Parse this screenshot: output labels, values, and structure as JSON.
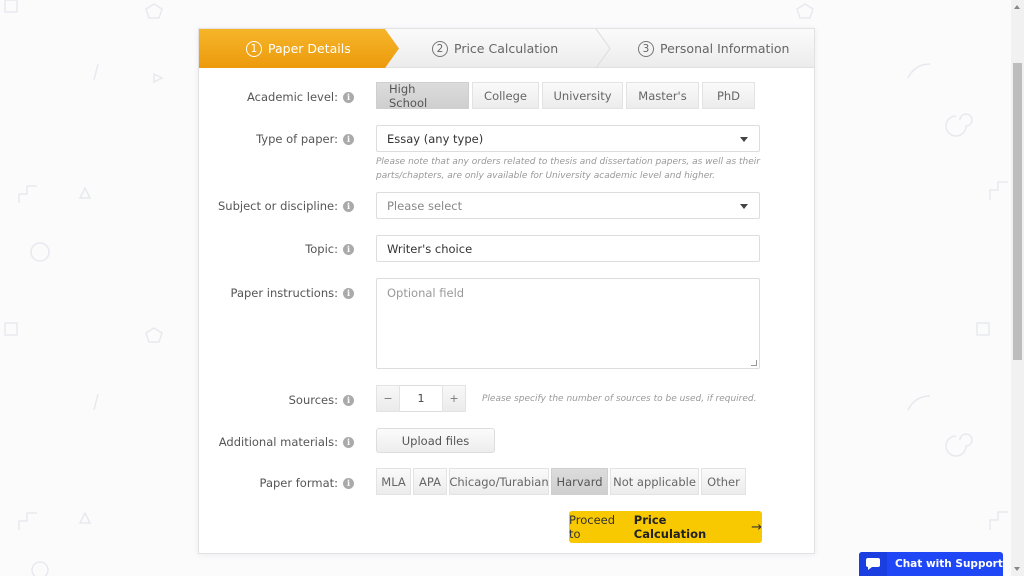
{
  "steps": [
    {
      "num": "1",
      "label": "Paper Details",
      "active": true
    },
    {
      "num": "2",
      "label": "Price Calculation",
      "active": false
    },
    {
      "num": "3",
      "label": "Personal Information",
      "active": false
    }
  ],
  "form": {
    "academic_level": {
      "label": "Academic level:",
      "options": [
        "High School",
        "College",
        "University",
        "Master's",
        "PhD"
      ],
      "selected": "High School"
    },
    "type_of_paper": {
      "label": "Type of paper:",
      "value": "Essay (any type)",
      "note": "Please note that any orders related to thesis and dissertation papers, as well as their parts/chapters, are only available for University academic level and higher."
    },
    "subject": {
      "label": "Subject or discipline:",
      "placeholder": "Please select"
    },
    "topic": {
      "label": "Topic:",
      "value": "Writer's choice"
    },
    "instructions": {
      "label": "Paper instructions:",
      "placeholder": "Optional field"
    },
    "sources": {
      "label": "Sources:",
      "minus": "−",
      "value": "1",
      "plus": "+",
      "hint": "Please specify the number of sources to be used, if required."
    },
    "additional_materials": {
      "label": "Additional materials:",
      "button": "Upload files"
    },
    "paper_format": {
      "label": "Paper format:",
      "options": [
        "MLA",
        "APA",
        "Chicago/Turabian",
        "Harvard",
        "Not applicable",
        "Other"
      ],
      "selected": "Harvard"
    },
    "info_icon": "i"
  },
  "proceed": {
    "prefix": "Proceed to",
    "bold": "Price Calculation",
    "arrow": "→"
  },
  "chat": {
    "label": "Chat with Support"
  },
  "colors": {
    "accent_orange": "#f0a21a",
    "proceed_yellow": "#f8c800",
    "chat_blue": "#1f47f5"
  }
}
